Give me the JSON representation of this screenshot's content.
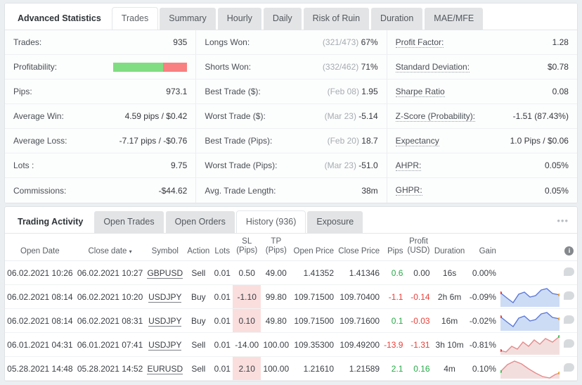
{
  "stats_panel": {
    "tabs": [
      {
        "label": "Advanced Statistics",
        "state": "head"
      },
      {
        "label": "Trades",
        "state": "active"
      },
      {
        "label": "Summary",
        "state": "idle"
      },
      {
        "label": "Hourly",
        "state": "idle"
      },
      {
        "label": "Daily",
        "state": "idle"
      },
      {
        "label": "Risk of Ruin",
        "state": "idle"
      },
      {
        "label": "Duration",
        "state": "idle"
      },
      {
        "label": "MAE/MFE",
        "state": "idle"
      }
    ],
    "columns": [
      [
        {
          "label": "Trades:",
          "value": "935"
        },
        {
          "label": "Profitability:",
          "value": "",
          "type": "bar",
          "green_pct": 67,
          "red_pct": 33
        },
        {
          "label": "Pips:",
          "value": "973.1"
        },
        {
          "label": "Average Win:",
          "value": "4.59 pips / $0.42"
        },
        {
          "label": "Average Loss:",
          "value": "-7.17 pips / -$0.76"
        },
        {
          "label": "Lots :",
          "value": "9.75"
        },
        {
          "label": "Commissions:",
          "value": "-$44.62"
        }
      ],
      [
        {
          "label": "Longs Won:",
          "muted": "(321/473)",
          "value": "67%"
        },
        {
          "label": "Shorts Won:",
          "muted": "(332/462)",
          "value": "71%"
        },
        {
          "label": "Best Trade ($):",
          "muted": "(Feb 08)",
          "value": "1.95"
        },
        {
          "label": "Worst Trade ($):",
          "muted": "(Mar 23)",
          "value": "-5.14"
        },
        {
          "label": "Best Trade (Pips):",
          "muted": "(Feb 20)",
          "value": "18.7"
        },
        {
          "label": "Worst Trade (Pips):",
          "muted": "(Mar 23)",
          "value": "-51.0"
        },
        {
          "label": "Avg. Trade Length:",
          "muted": "",
          "value": "38m"
        }
      ],
      [
        {
          "label": "Profit Factor:",
          "value": "1.28",
          "dotted": true
        },
        {
          "label": "Standard Deviation:",
          "value": "$0.78",
          "dotted": true
        },
        {
          "label": "Sharpe Ratio",
          "value": "0.08",
          "dotted": true
        },
        {
          "label": "Z-Score (Probability):",
          "value": "-1.51 (87.43%)",
          "dotted": true
        },
        {
          "label": "Expectancy",
          "value": "1.0 Pips / $0.06",
          "dotted": true
        },
        {
          "label": "AHPR:",
          "value": "0.05%",
          "dotted": true
        },
        {
          "label": "GHPR:",
          "value": "0.05%",
          "dotted": true
        }
      ]
    ]
  },
  "activity_panel": {
    "tabs": [
      {
        "label": "Trading Activity",
        "state": "head"
      },
      {
        "label": "Open Trades",
        "state": "idle"
      },
      {
        "label": "Open Orders",
        "state": "idle"
      },
      {
        "label": "History (936)",
        "state": "active"
      },
      {
        "label": "Exposure",
        "state": "idle"
      }
    ],
    "menu_icon": "•••",
    "headers": {
      "open_date": "Open Date",
      "close_date": "Close date",
      "sort_arrow": "▾",
      "symbol": "Symbol",
      "action": "Action",
      "lots": "Lots",
      "sl_l1": "SL",
      "sl_l2": "(Pips)",
      "tp_l1": "TP",
      "tp_l2": "(Pips)",
      "open_price": "Open Price",
      "close_price": "Close Price",
      "pips": "Pips",
      "profit_l1": "Profit",
      "profit_l2": "(USD)",
      "duration": "Duration",
      "gain": "Gain",
      "info": "i"
    },
    "rows": [
      {
        "open_date": "06.02.2021 10:26",
        "close_date": "06.02.2021 10:27",
        "symbol": "GBPUSD",
        "action": "Sell",
        "lots": "0.01",
        "sl": "0.50",
        "sl_hl": false,
        "tp": "49.00",
        "open_price": "1.41352",
        "close_price": "1.41346",
        "pips": "0.6",
        "pips_sign": "pos",
        "profit": "0.00",
        "profit_sign": "flat",
        "duration": "16s",
        "gain": "0.00%",
        "spark": "none"
      },
      {
        "open_date": "06.02.2021 08:14",
        "close_date": "06.02.2021 10:20",
        "symbol": "USDJPY",
        "action": "Buy",
        "lots": "0.01",
        "sl": "-1.10",
        "sl_hl": true,
        "tp": "99.80",
        "open_price": "109.71500",
        "close_price": "109.70400",
        "pips": "-1.1",
        "pips_sign": "neg",
        "profit": "-0.14",
        "profit_sign": "neg",
        "duration": "2h 6m",
        "gain": "-0.09%",
        "spark": "blue"
      },
      {
        "open_date": "06.02.2021 08:14",
        "close_date": "06.02.2021 08:31",
        "symbol": "USDJPY",
        "action": "Buy",
        "lots": "0.01",
        "sl": "0.10",
        "sl_hl": true,
        "tp": "49.80",
        "open_price": "109.71500",
        "close_price": "109.71600",
        "pips": "0.1",
        "pips_sign": "pos",
        "profit": "-0.03",
        "profit_sign": "neg",
        "duration": "16m",
        "gain": "-0.02%",
        "spark": "blue"
      },
      {
        "open_date": "06.01.2021 04:31",
        "close_date": "06.01.2021 07:41",
        "symbol": "USDJPY",
        "action": "Sell",
        "lots": "0.01",
        "sl": "-14.00",
        "sl_hl": false,
        "tp": "100.00",
        "open_price": "109.35300",
        "close_price": "109.49200",
        "pips": "-13.9",
        "pips_sign": "neg",
        "profit": "-1.31",
        "profit_sign": "neg",
        "duration": "3h 10m",
        "gain": "-0.81%",
        "spark": "red"
      },
      {
        "open_date": "05.28.2021 14:48",
        "close_date": "05.28.2021 14:52",
        "symbol": "EURUSD",
        "action": "Sell",
        "lots": "0.01",
        "sl": "2.10",
        "sl_hl": true,
        "tp": "100.00",
        "open_price": "1.21610",
        "close_price": "1.21589",
        "pips": "2.1",
        "pips_sign": "pos",
        "profit": "0.16",
        "profit_sign": "pos",
        "duration": "4m",
        "gain": "0.10%",
        "spark": "redarc"
      }
    ]
  },
  "colors": {
    "green": "#2aa84a",
    "red": "#e8403a",
    "bar_green": "#81dd81",
    "bar_red": "#f98080",
    "sl_highlight": "#fadede"
  }
}
